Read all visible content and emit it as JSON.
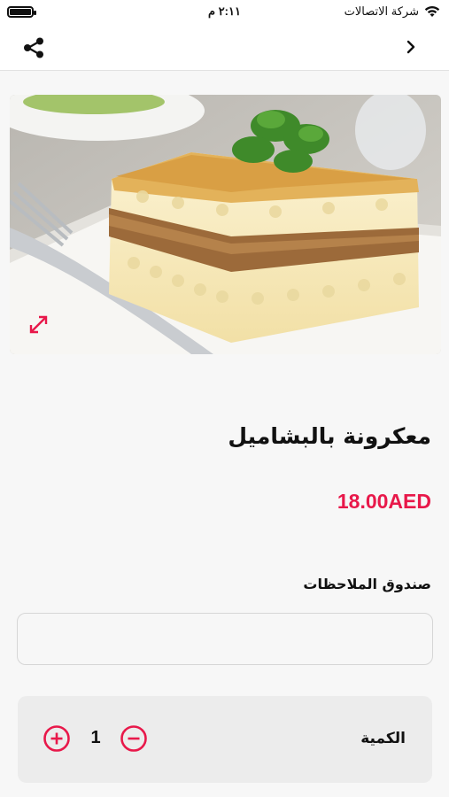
{
  "status_bar": {
    "carrier": "شركة الاتصالات",
    "time": "٢:١١ م",
    "battery_icon": "battery-full-icon",
    "wifi_icon": "wifi-icon"
  },
  "nav": {
    "share_icon": "share-icon",
    "back_icon": "chevron-right-icon"
  },
  "hero": {
    "expand_icon": "expand-icon"
  },
  "product": {
    "name": "معكرونة بالبشاميل",
    "price": "18.00AED"
  },
  "notes": {
    "label": "صندوق الملاحظات",
    "value": "",
    "placeholder": ""
  },
  "quantity": {
    "label": "الكمية",
    "value": "1",
    "plus_icon": "plus-circle-icon",
    "minus_icon": "minus-circle-icon"
  },
  "colors": {
    "accent": "#e8184a",
    "background": "#f7f7f7",
    "card": "#ececec"
  }
}
